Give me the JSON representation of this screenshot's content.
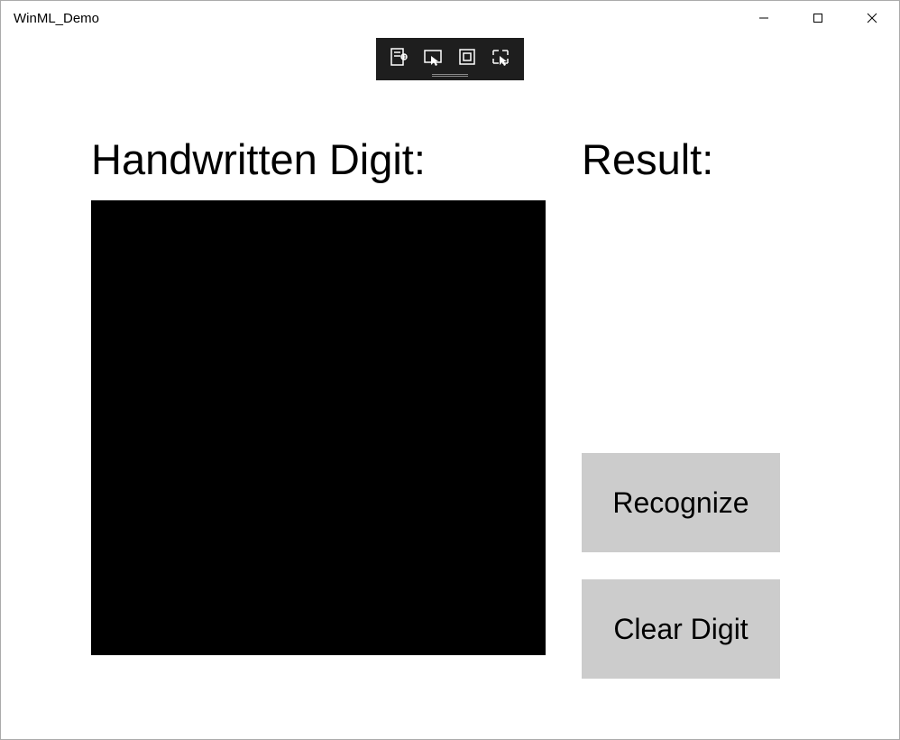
{
  "window": {
    "title": "WinML_Demo"
  },
  "headings": {
    "canvas_label": "Handwritten Digit:",
    "result_label": "Result:"
  },
  "buttons": {
    "recognize": "Recognize",
    "clear": "Clear Digit"
  },
  "debug_toolbar": {
    "icon1": "visual-tree-icon",
    "icon2": "selection-icon",
    "icon3": "layout-adorners-icon",
    "icon4": "track-focus-icon"
  }
}
